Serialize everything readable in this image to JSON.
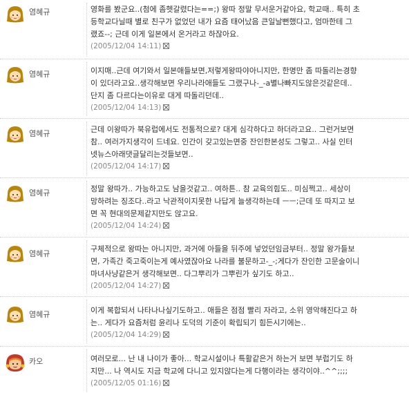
{
  "comments": [
    {
      "author": "염혜규",
      "avatar": "girl-avatar-icon",
      "lines": [
        "영화를 봤군요..(첨에 좀헷갈렸다는==;) 왕따 정말 무서운거같아요, 학교때.. 특히 초",
        "등학교다닐때 별로 친구가 없었던 내가 요즘 태어났음 큰일날뻔했다고, 엄마한테 그",
        "랬죠--; 근데 이게 일본에서 온거라고 하잖아요."
      ],
      "date": "(2005/12/04 14:11)"
    },
    {
      "author": "염혜규",
      "avatar": "girl-avatar-icon",
      "lines": [
        "이지매..근데 여기와서 일본애들보면,저렇게왕따야아니지만, 한명만 좀 따돌리는경향",
        "이 있더라고요..생각해보면 우리나라애들도 그랬구나-_-a별나빠지도않은것같은데..",
        "단지 좀 다르다는이유로 대게 따돌리던데.."
      ],
      "date": "(2005/12/04 14:13)"
    },
    {
      "author": "염혜규",
      "avatar": "girl-avatar-icon",
      "lines": [
        "근데 이왕따가 북유럽에서도 전통적으로? 대게 심각하다고 하더라고요.. 그런거보면",
        "참.. 여러가지생각이 드네요. 인간이 갖고있는면중 잔인한본성도 그렇고.. 사실 인터",
        "넷뉴스아래댓글달리는것들보면.."
      ],
      "date": "(2005/12/04 14:17)"
    },
    {
      "author": "염혜규",
      "avatar": "girl-avatar-icon",
      "lines": [
        "정말 왕따가.. 가능하고도 남을것같고.. 여하튼.. 참 교육의힘도.. 미심쩍고.. 세상이",
        "망하려는 징조다..라고 낙관적이지못한 나답게 늘생각하는데 ㅡㅡ;근데 또 따지고 보",
        "면 꼭 현대의문제같지만도 않고요."
      ],
      "date": "(2005/12/04 14:24)"
    },
    {
      "author": "염혜규",
      "avatar": "girl-avatar-icon",
      "lines": [
        "구체적으로 왕따는 아니지만, 과거에 아들을 뒤주에 넣었던임금부터.. 정말 왕가들보",
        "면, 가족간 죽고죽이는게 예사였잖아요 나라를 불문하고-_-;게다가 잔인한 고문술이니",
        "마녀사냥같은거 생각해보면.. 다그뿌리가 그뿌린가 싶기도 하고.."
      ],
      "date": "(2005/12/04 14:27)"
    },
    {
      "author": "염혜규",
      "avatar": "girl-avatar-icon",
      "lines": [
        "이게 복합되서 나타나나싶기도하고.. 애들은 점점 빨리 자라고, 소위 영악해진다고 하",
        "는.. 게다가 요즘처럼 윤리나 도덕의 기준이 확립되기 힘든시기에는.."
      ],
      "date": "(2005/12/04 14:29)"
    },
    {
      "author": "카오",
      "avatar": "red-hood-avatar-icon",
      "lines": [
        "여러모로... 난 내 나이가 좋아... 학교시설이나 특활같은거 하는거 보면 부럽기도 하",
        "지만... 나 역시도 지금 학교에 다니고 있지않다는게 다행이라는 생각이야..^^;;;;"
      ],
      "date": "(2005/12/05 01:16)"
    }
  ]
}
